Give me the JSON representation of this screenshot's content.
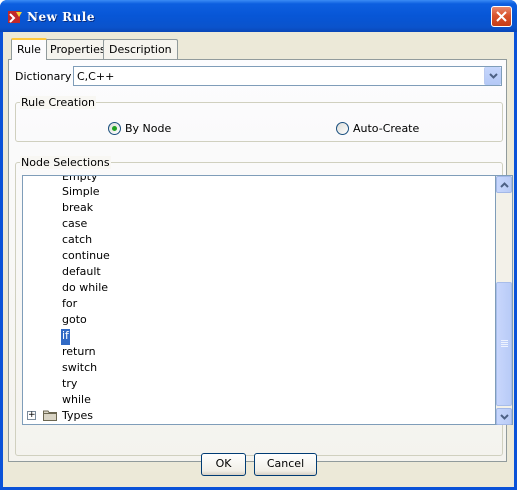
{
  "window": {
    "title": "New Rule"
  },
  "tabs": [
    {
      "label": "Rule",
      "active": true
    },
    {
      "label": "Properties",
      "active": false
    },
    {
      "label": "Description",
      "active": false
    }
  ],
  "dictionary": {
    "label": "Dictionary",
    "value": "C,C++"
  },
  "rule_creation": {
    "title": "Rule Creation",
    "options": [
      {
        "label": "By Node",
        "selected": true
      },
      {
        "label": "Auto-Create",
        "selected": false
      }
    ]
  },
  "node_selections": {
    "title": "Node Selections",
    "items": [
      "Empty",
      "Simple",
      "break",
      "case",
      "catch",
      "continue",
      "default",
      "do while",
      "for",
      "goto",
      "if",
      "return",
      "switch",
      "try",
      "while"
    ],
    "selected": "if",
    "folder": {
      "label": "Types",
      "expanded": false,
      "expander": "+"
    }
  },
  "buttons": {
    "ok": "OK",
    "cancel": "Cancel"
  },
  "colors": {
    "titlebar": "#0a53cc",
    "selection": "#316ac5",
    "dialog_bg": "#ece9d8"
  }
}
